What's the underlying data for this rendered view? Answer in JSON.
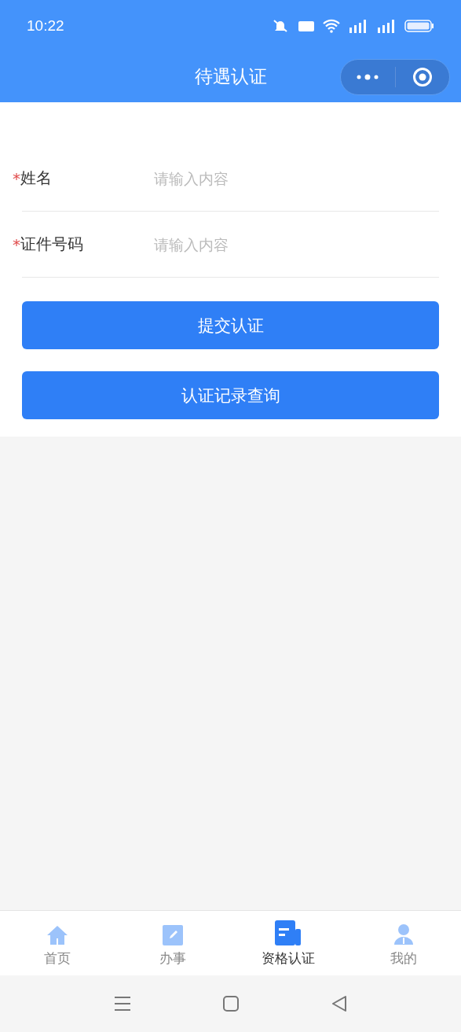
{
  "status_bar": {
    "time": "10:22"
  },
  "header": {
    "title": "待遇认证"
  },
  "form": {
    "fields": [
      {
        "required_mark": "*",
        "label": "姓名",
        "placeholder": "请输入内容"
      },
      {
        "required_mark": "*",
        "label": "证件号码",
        "placeholder": "请输入内容"
      }
    ],
    "buttons": [
      "提交认证",
      "认证记录查询"
    ]
  },
  "tab_bar": [
    {
      "label": "首页",
      "kind": "home",
      "selected": false
    },
    {
      "label": "办事",
      "kind": "edit",
      "selected": false
    },
    {
      "label": "资格认证",
      "kind": "doc",
      "selected": true
    },
    {
      "label": "我的",
      "kind": "person",
      "selected": false
    }
  ]
}
